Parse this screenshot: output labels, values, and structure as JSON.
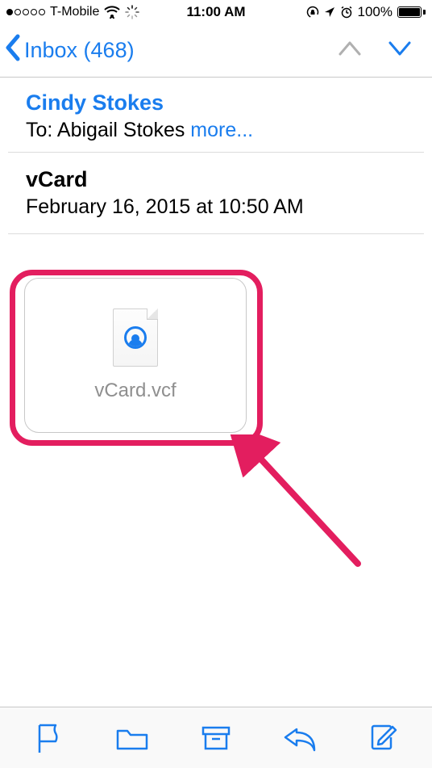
{
  "statusBar": {
    "carrier": "T-Mobile",
    "time": "11:00 AM",
    "batteryPercent": "100%"
  },
  "nav": {
    "backLabel": "Inbox (468)"
  },
  "message": {
    "from": "Cindy Stokes",
    "toPrefix": "To: ",
    "toName": "Abigail Stokes ",
    "moreLabel": "more...",
    "subject": "vCard",
    "date": "February 16, 2015 at 10:50 AM"
  },
  "attachment": {
    "filename": "vCard.vcf"
  }
}
